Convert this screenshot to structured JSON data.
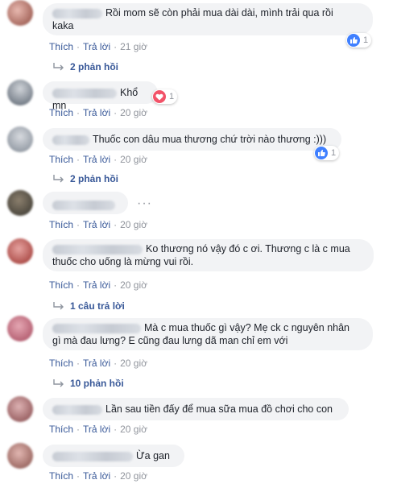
{
  "actions": {
    "like": "Thích",
    "reply": "Trả lời",
    "separator": "·"
  },
  "comments": [
    {
      "text": "Rồi mom sẽ còn phải mua dài dài, mình trải qua rồi\nkaka",
      "time": "21 giờ",
      "reaction": {
        "type": "like",
        "count": "1"
      },
      "replies": "2 phản hồi"
    },
    {
      "text": "Khổ mn",
      "time": "20 giờ",
      "reaction": {
        "type": "love",
        "count": "1"
      }
    },
    {
      "text": "Thuốc con dâu mua thương chứ trời nào thương :)))",
      "time": "20 giờ",
      "reaction": {
        "type": "like",
        "count": "1"
      },
      "replies": "2 phản hồi"
    },
    {
      "text": "",
      "time": "20 giờ",
      "more": "···"
    },
    {
      "text": "Ko thương nó vậy đó c ơi. Thương c là c mua\nthuốc cho uống là mừng vui rồi.",
      "time": "20 giờ",
      "replies": "1 câu trả lời"
    },
    {
      "text": "Mà c mua thuốc gì vậy? Mẹ ck c nguyên nhân\ngì mà đau lưng? E cũng đau lưng dã man chỉ em với",
      "time": "20 giờ",
      "replies": "10 phản hồi"
    },
    {
      "text": "Lần sau tiền đấy để mua sữa mua đồ chơi cho con",
      "time": "20 giờ"
    },
    {
      "text": "Ừa gan",
      "time": "20 giờ"
    }
  ],
  "colors": {
    "link": "#385898",
    "meta": "#90949c",
    "bubble": "#f2f3f5",
    "like": "#4080ff",
    "love": "#f25268"
  }
}
